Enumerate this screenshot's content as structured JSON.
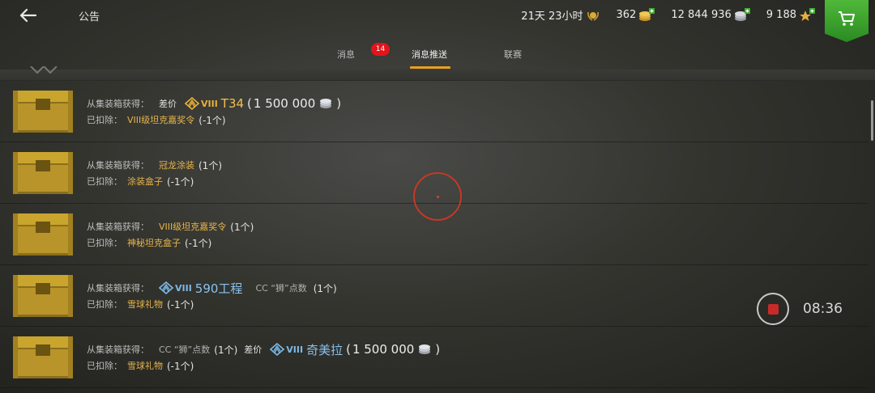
{
  "header": {
    "title": "公告",
    "timer": "21天 23小时",
    "gold": "362",
    "credits": "12 844 936",
    "free_xp": "9 188"
  },
  "tabs": [
    {
      "label": "消息",
      "badge": "14"
    },
    {
      "label": "消息推送",
      "active": true
    },
    {
      "label": "联赛"
    }
  ],
  "messages": [
    {
      "prefix": "从集装箱获得：",
      "diff_label": "差价",
      "tier": "VIII",
      "tank": "T34",
      "amount": "1 500 000",
      "deducted_label": "已扣除：",
      "deducted_item": "VIII级坦克嘉奖令",
      "deducted_count": "(-1个)"
    },
    {
      "prefix": "从集装箱获得：",
      "reward": "冠龙涂装",
      "reward_count": "(1个)",
      "deducted_label": "已扣除：",
      "deducted_item": "涂装盒子",
      "deducted_count": "(-1个)"
    },
    {
      "prefix": "从集装箱获得：",
      "reward": "VIII级坦克嘉奖令",
      "reward_count": "(1个)",
      "deducted_label": "已扣除：",
      "deducted_item": "神秘坦克盒子",
      "deducted_count": "(-1个)"
    },
    {
      "prefix": "从集装箱获得：",
      "tier": "VIII",
      "tank": "590工程",
      "extra": "CC “狮”点数",
      "extra_count": "(1个)",
      "deducted_label": "已扣除：",
      "deducted_item": "雪球礼物",
      "deducted_count": "(-1个)"
    },
    {
      "prefix": "从集装箱获得：",
      "extra": "CC “狮”点数",
      "extra_count": "(1个)",
      "diff_label": "差价",
      "tier": "VIII",
      "tank": "奇美拉",
      "amount": "1 500 000",
      "deducted_label": "已扣除：",
      "deducted_item": "雪球礼物",
      "deducted_count": "(-1个)"
    }
  ],
  "recorder": {
    "time": "08:36"
  },
  "colors": {
    "accent": "#e8a020",
    "badge": "#e0151c",
    "shop": "#3fa52e",
    "gold_text": "#e6b54a",
    "tank_blue": "#88c2ee"
  },
  "icons": [
    "back-arrow-icon",
    "gold-coins-icon",
    "silver-coins-icon",
    "star-xp-icon",
    "cart-icon",
    "crate-icon",
    "tier-premium-gold-icon",
    "tier-premium-blue-icon",
    "silver-icon",
    "record-stop-icon",
    "target-reticle-icon"
  ]
}
